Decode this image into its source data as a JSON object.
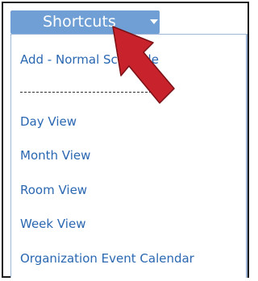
{
  "shortcuts": {
    "button_label": "Shortcuts",
    "caret_icon": "caret-down-icon",
    "menu_items": [
      "Add - Normal Schedule",
      "Day View",
      "Month View",
      "Room View",
      "Week View",
      "Organization Event Calendar"
    ]
  },
  "annotation": {
    "icon": "red-pointer-arrow-icon",
    "color": "#c8232c"
  },
  "colors": {
    "button": "#6f9fd4",
    "link": "#2a67b1",
    "menu_border": "#9fb6d8"
  }
}
